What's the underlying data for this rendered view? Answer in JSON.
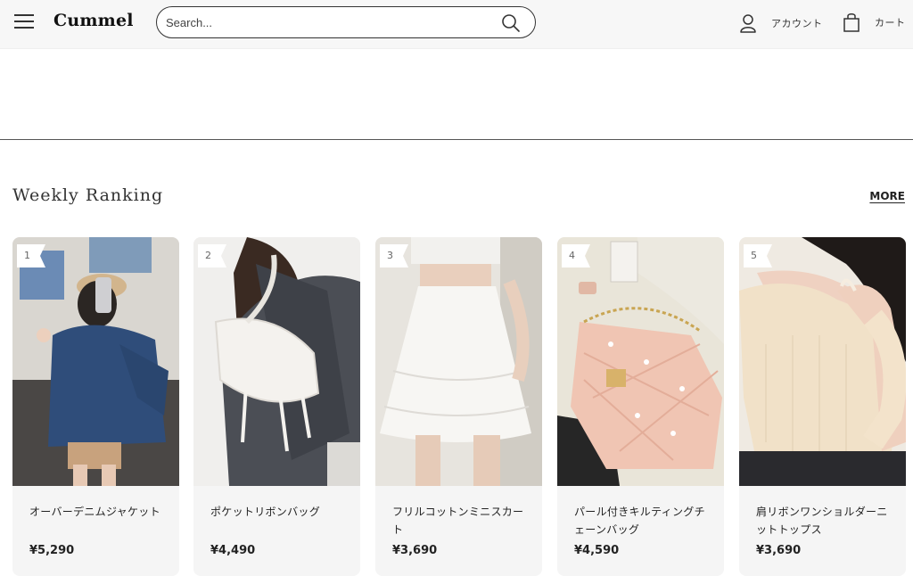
{
  "header": {
    "logo": "Cummel",
    "search_placeholder": "Search...",
    "account_label": "アカウント",
    "cart_label": "カート",
    "icons": {
      "menu": "hamburger-icon",
      "search": "search-icon",
      "account": "user-icon",
      "cart": "shopping-bag-icon"
    }
  },
  "ranking": {
    "title": "Weekly Ranking",
    "more_label": "MORE",
    "items": [
      {
        "rank": "1",
        "name": "オーバーデニムジャケット",
        "price": "¥5,290"
      },
      {
        "rank": "2",
        "name": "ポケットリボンバッグ",
        "price": "¥4,490"
      },
      {
        "rank": "3",
        "name": "フリルコットンミニスカート",
        "price": "¥3,690"
      },
      {
        "rank": "4",
        "name": "パール付きキルティングチェーンバッグ",
        "price": "¥4,590"
      },
      {
        "rank": "5",
        "name": "肩リボンワンショルダーニットトップス",
        "price": "¥3,690"
      }
    ]
  }
}
